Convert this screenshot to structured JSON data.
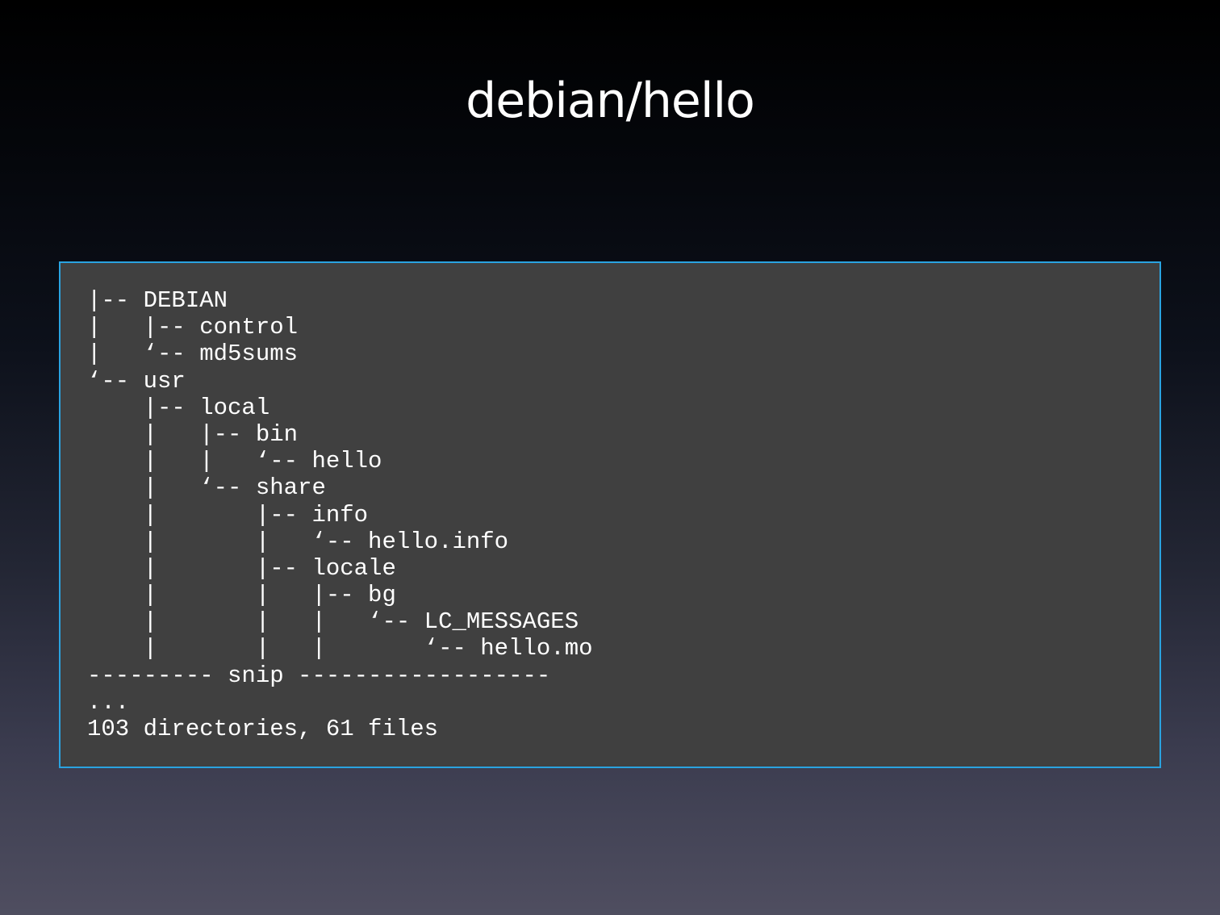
{
  "slide": {
    "title": "debian/hello"
  },
  "code": {
    "lines": [
      "|-- DEBIAN",
      "|   |-- control",
      "|   ‘-- md5sums",
      "‘-- usr",
      "    |-- local",
      "    |   |-- bin",
      "    |   |   ‘-- hello",
      "    |   ‘-- share",
      "    |       |-- info",
      "    |       |   ‘-- hello.info",
      "    |       |-- locale",
      "    |       |   |-- bg",
      "    |       |   |   ‘-- LC_MESSAGES",
      "    |       |   |       ‘-- hello.mo",
      "--------- snip ------------------",
      "...",
      "103 directories, 61 files"
    ]
  },
  "colors": {
    "box_border": "#2aa3e0",
    "box_background": "#404040",
    "text": "#ffffff"
  }
}
